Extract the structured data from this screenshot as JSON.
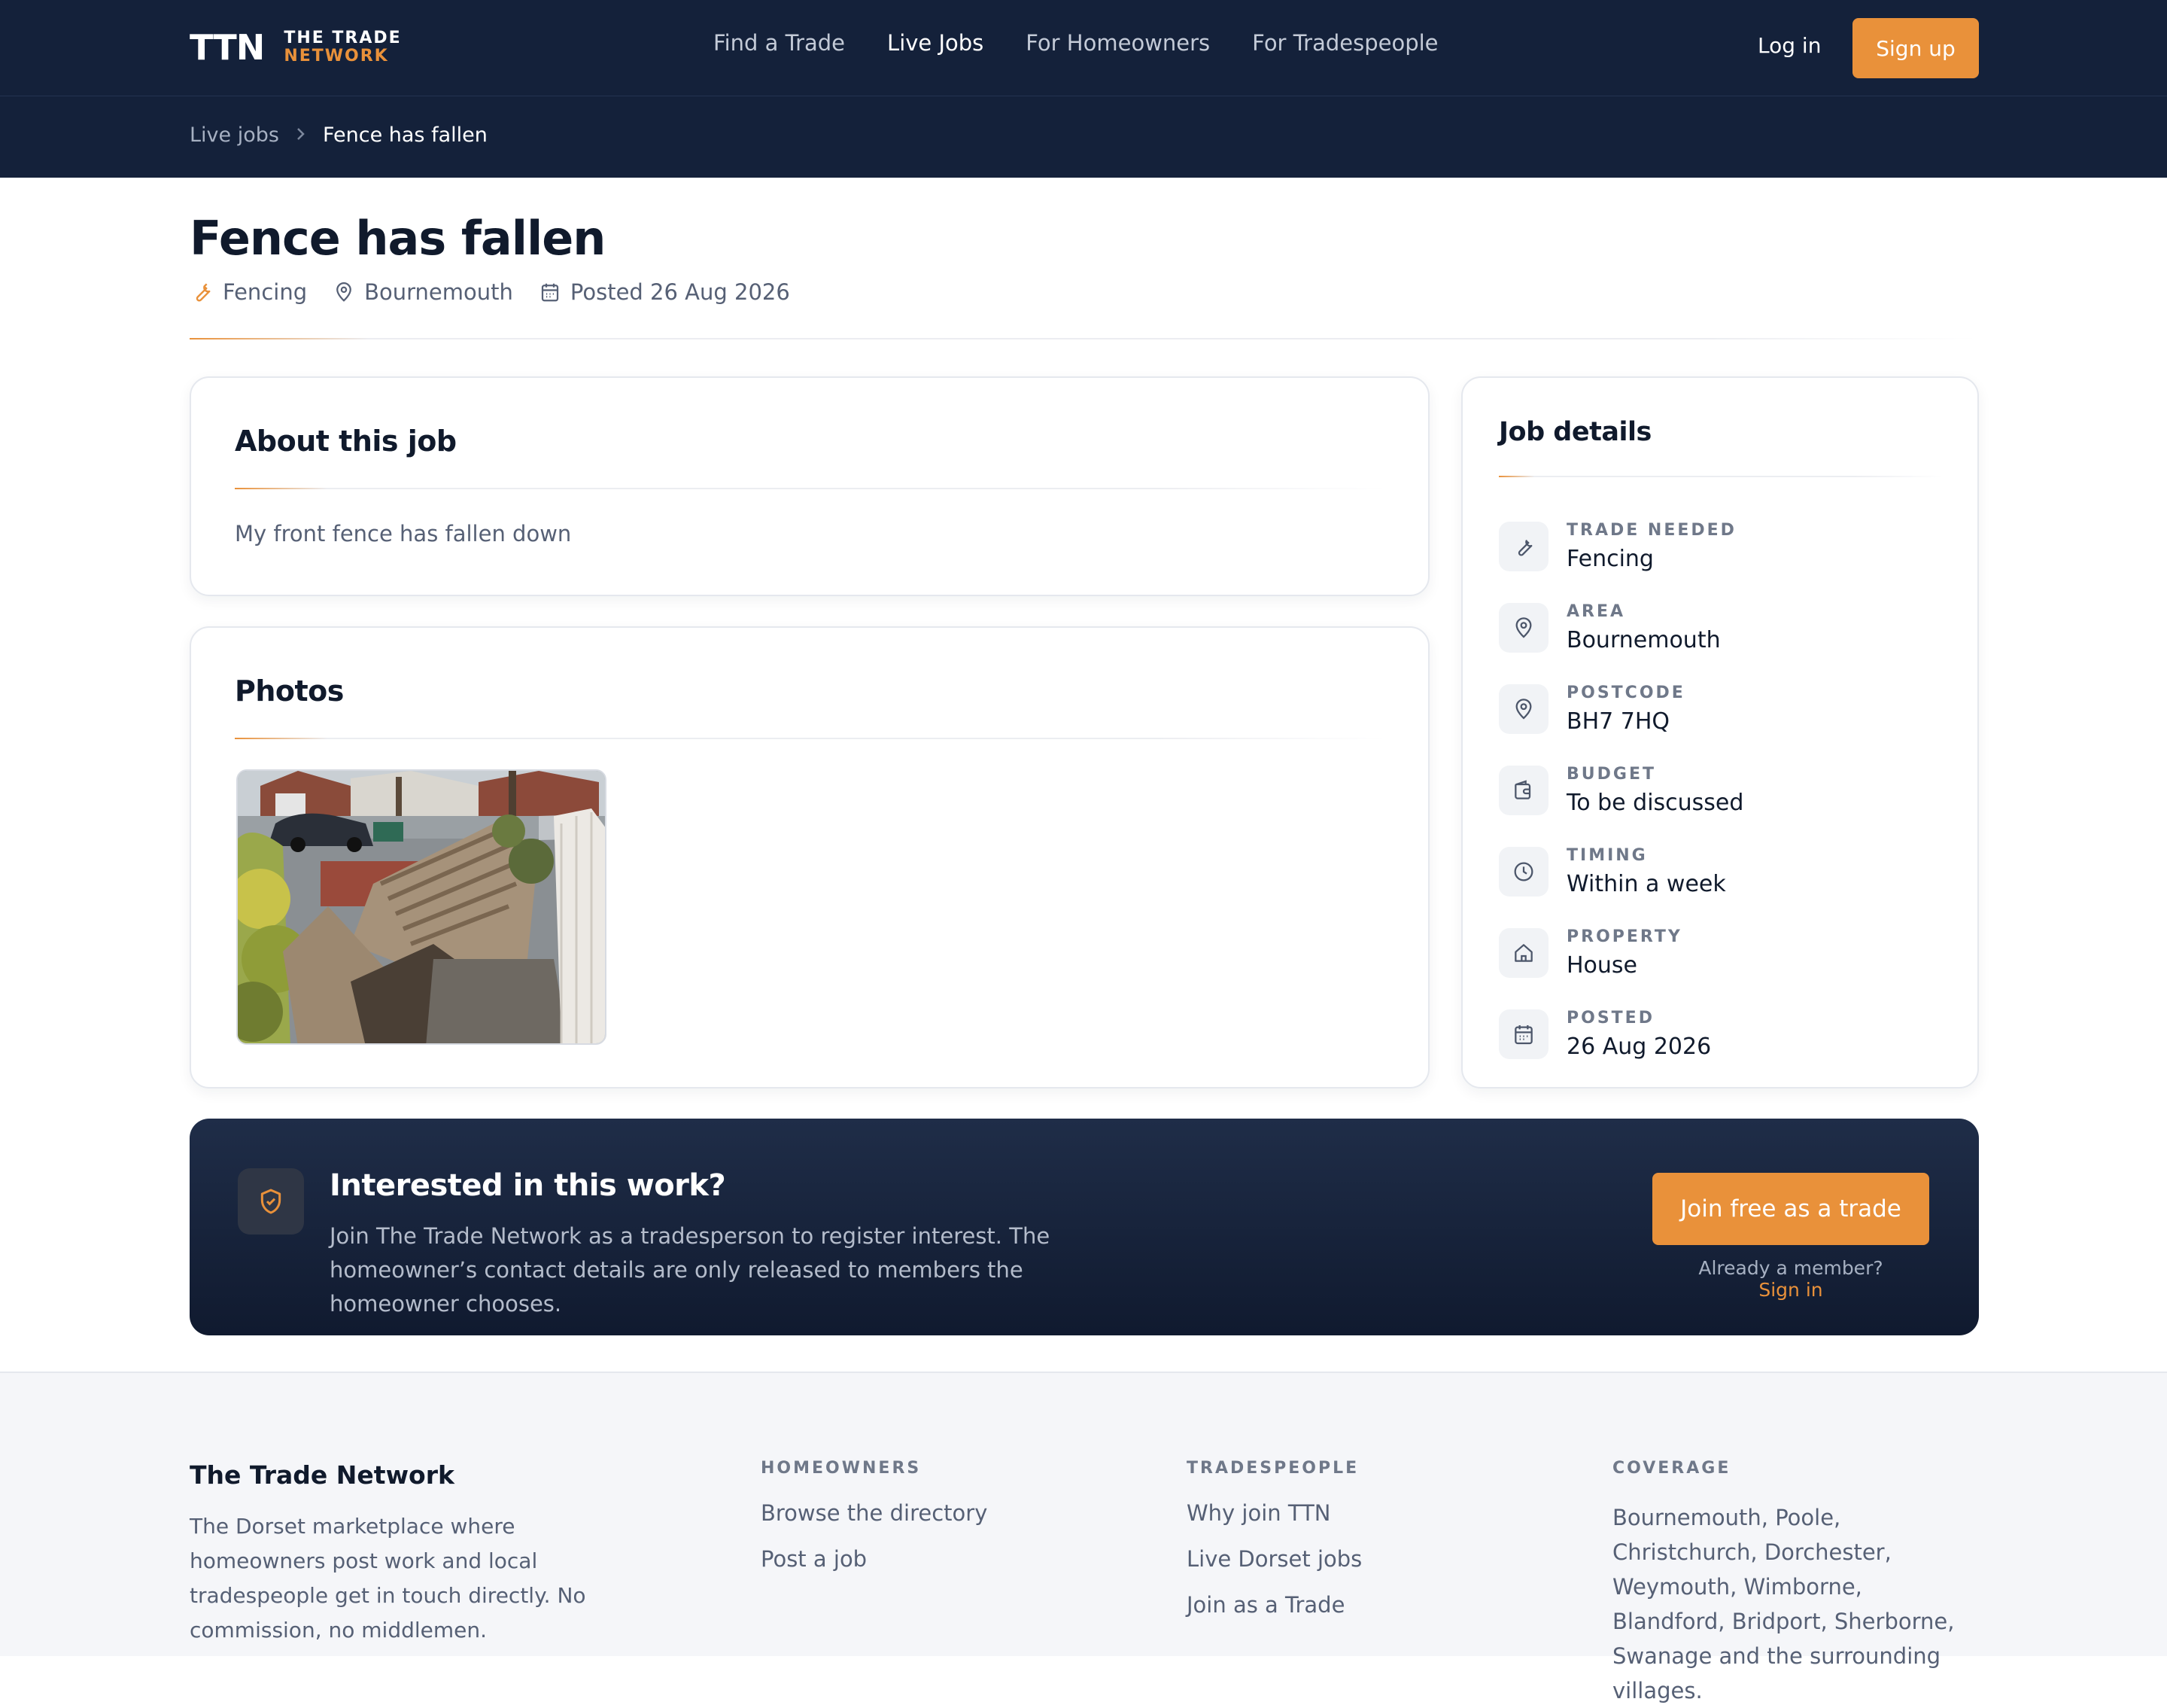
{
  "logo": {
    "mark": "TTN",
    "line1": "THE TRADE",
    "line2": "NETWORK"
  },
  "nav": {
    "links": [
      "Find a Trade",
      "Live Jobs",
      "For Homeowners",
      "For Tradespeople"
    ],
    "login": "Log in",
    "signup": "Sign up"
  },
  "breadcrumb": {
    "parent": "Live jobs",
    "current": "Fence has fallen"
  },
  "job": {
    "title": "Fence has fallen",
    "trade": "Fencing",
    "location": "Bournemouth",
    "posted": "Posted 26 Aug 2026"
  },
  "about": {
    "heading": "About this job",
    "text": "My front fence has fallen down"
  },
  "photos": {
    "heading": "Photos"
  },
  "details": {
    "heading": "Job details",
    "rows": [
      {
        "label": "TRADE NEEDED",
        "value": "Fencing",
        "icon": "wrench-icon"
      },
      {
        "label": "AREA",
        "value": "Bournemouth",
        "icon": "map-pin-icon"
      },
      {
        "label": "POSTCODE",
        "value": "BH7 7HQ",
        "icon": "map-pin-icon"
      },
      {
        "label": "BUDGET",
        "value": "To be discussed",
        "icon": "wallet-icon"
      },
      {
        "label": "TIMING",
        "value": "Within a week",
        "icon": "clock-icon"
      },
      {
        "label": "PROPERTY",
        "value": "House",
        "icon": "home-icon"
      },
      {
        "label": "POSTED",
        "value": "26 Aug 2026",
        "icon": "calendar-icon"
      }
    ]
  },
  "cta": {
    "title": "Interested in this work?",
    "text": "Join The Trade Network as a tradesperson to register interest. The homeowner’s contact details are only released to members the homeowner chooses.",
    "button": "Join free as a trade",
    "member_prefix": "Already a member?",
    "member_link": "Sign in"
  },
  "footer": {
    "brand": "The Trade Network",
    "description": "The Dorset marketplace where homeowners post work and local tradespeople get in touch directly. No commission, no middlemen.",
    "homeowners": {
      "heading": "HOMEOWNERS",
      "links": [
        "Browse the directory",
        "Post a job"
      ]
    },
    "tradespeople": {
      "heading": "TRADESPEOPLE",
      "links": [
        "Why join TTN",
        "Live Dorset jobs",
        "Join as a Trade"
      ]
    },
    "coverage": {
      "heading": "COVERAGE",
      "text": "Bournemouth, Poole, Christchurch, Dorchester, Weymouth, Wimborne, Blandford, Bridport, Sherborne, Swanage and the surrounding villages."
    }
  },
  "colors": {
    "navy": "#14213a",
    "accent": "#e9913a",
    "text": "#101a2c",
    "muted": "#566075"
  }
}
